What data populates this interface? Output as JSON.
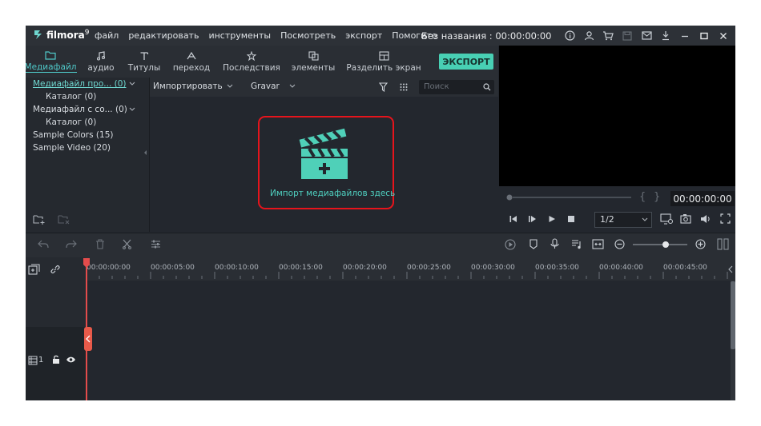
{
  "titlebar": {
    "app_name": "filmora",
    "app_version": "9",
    "menu": [
      "файл",
      "редактировать",
      "инструменты",
      "Посмотреть",
      "экспорт",
      "Помогите"
    ],
    "project_title": "Без названия : 00:00:00:00"
  },
  "toolbar": {
    "tabs": [
      {
        "label": "Медиафайл",
        "icon": "folder-icon",
        "active": true
      },
      {
        "label": "аудио",
        "icon": "music-note-icon",
        "active": false
      },
      {
        "label": "Титулы",
        "icon": "text-icon",
        "active": false
      },
      {
        "label": "переход",
        "icon": "transition-icon",
        "active": false
      },
      {
        "label": "Последствия",
        "icon": "effects-icon",
        "active": false
      },
      {
        "label": "элементы",
        "icon": "elements-icon",
        "active": false
      },
      {
        "label": "Разделить экран",
        "icon": "split-screen-icon",
        "active": false
      }
    ],
    "export_label": "ЭКСПОРТ"
  },
  "library": {
    "items": [
      {
        "label": "Медиафайл про... (0)",
        "selected": true
      },
      {
        "label": "Каталог (0)"
      },
      {
        "label": "Медиафайл с со... (0)"
      },
      {
        "label": "Каталог (0)"
      },
      {
        "label": "Sample Colors (15)"
      },
      {
        "label": "Sample Video (20)"
      }
    ]
  },
  "media": {
    "import_label": "Импортировать",
    "filter_label": "Gravar",
    "search_placeholder": "Поиск",
    "drop_hint": "Импорт медиафайлов здесь"
  },
  "preview": {
    "timecode": "00:00:00:00",
    "ratio": "1/2"
  },
  "timeline": {
    "ticks": [
      "00:00:00:00",
      "00:00:05:00",
      "00:00:10:00",
      "00:00:15:00",
      "00:00:20:00",
      "00:00:25:00",
      "00:00:30:00",
      "00:00:35:00",
      "00:00:40:00",
      "00:00:45:00"
    ],
    "track_label": "1"
  },
  "colors": {
    "accent": "#48d0b4",
    "highlight_border": "#e6141c",
    "playhead": "#e44c4c"
  }
}
